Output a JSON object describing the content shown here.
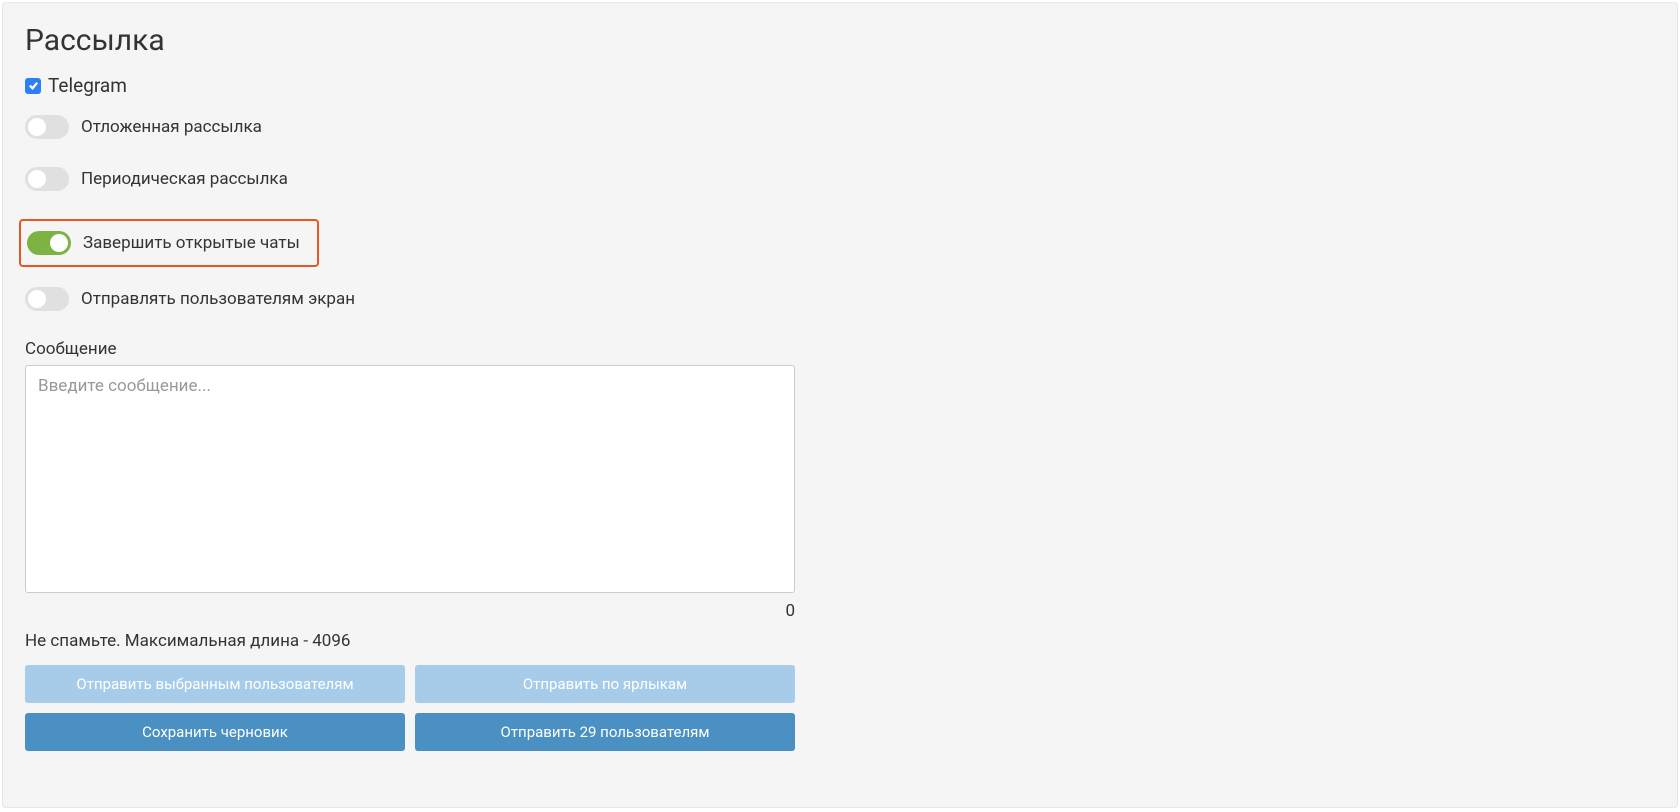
{
  "page_title": "Рассылка",
  "channel": {
    "telegram_label": "Telegram",
    "telegram_checked": true
  },
  "toggles": {
    "delayed": {
      "label": "Отложенная рассылка",
      "on": false
    },
    "periodic": {
      "label": "Периодическая рассылка",
      "on": false
    },
    "close_chats": {
      "label": "Завершить открытые чаты",
      "on": true,
      "highlighted": true
    },
    "send_screen": {
      "label": "Отправлять пользователям экран",
      "on": false
    }
  },
  "message": {
    "label": "Сообщение",
    "placeholder": "Введите сообщение...",
    "value": "",
    "char_count": "0",
    "hint": "Не спамьте. Максимальная длина - 4096"
  },
  "buttons": {
    "send_selected": "Отправить выбранным пользователям",
    "send_by_tags": "Отправить по ярлыкам",
    "save_draft": "Сохранить черновик",
    "send_to_users": "Отправить 29 пользователям"
  }
}
